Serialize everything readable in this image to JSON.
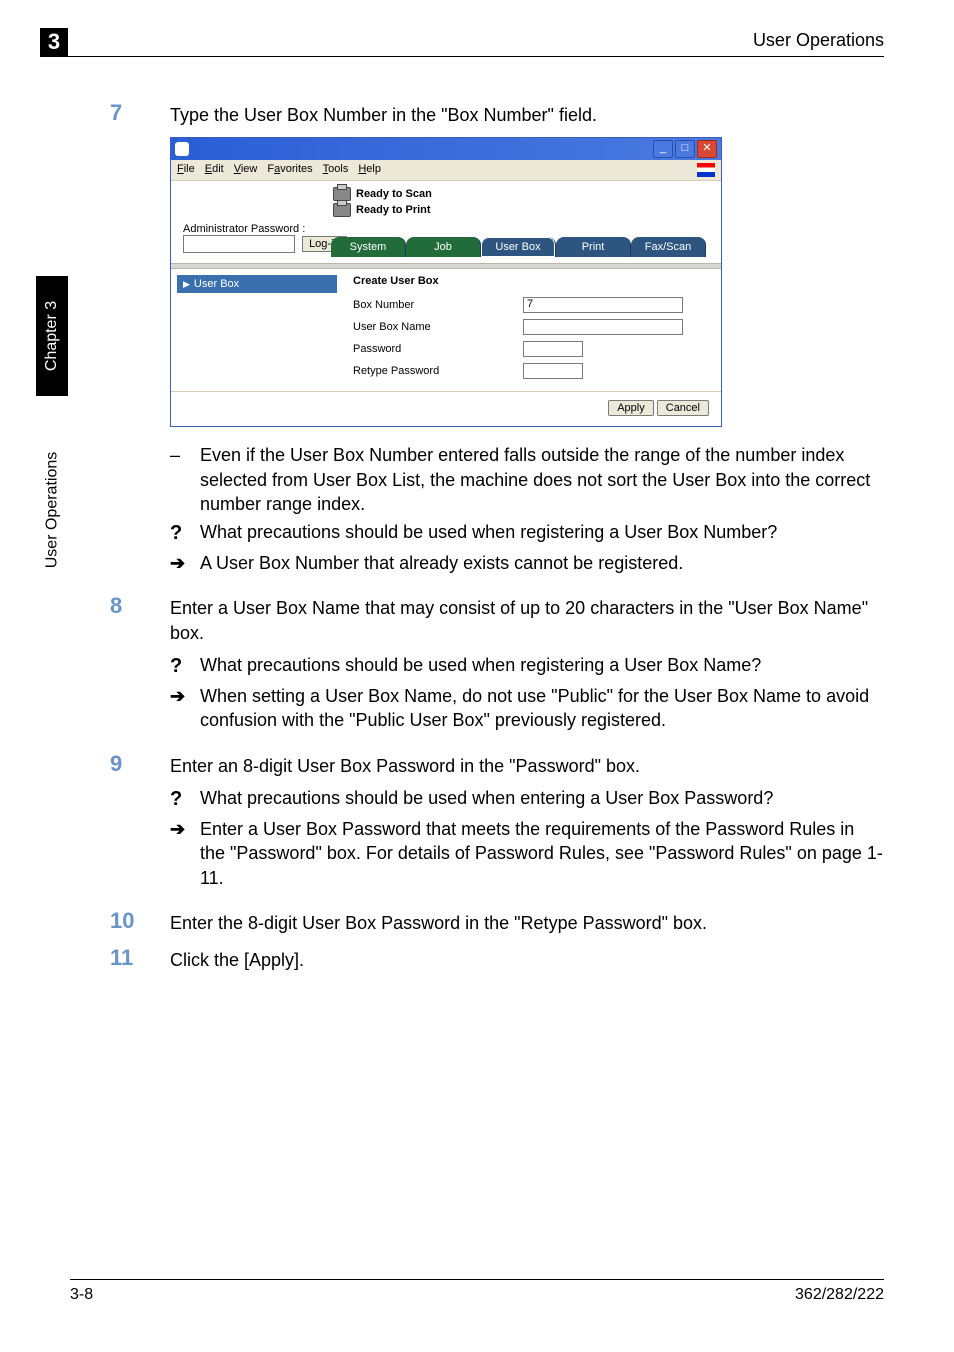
{
  "header": {
    "chapter_num": "3",
    "title": "User Operations"
  },
  "side": {
    "chapter_label": "Chapter 3",
    "section_label": "User Operations"
  },
  "steps": {
    "s7": {
      "num": "7",
      "text": "Type the User Box Number in the \"Box Number\" field."
    },
    "s8": {
      "num": "8",
      "text": "Enter a User Box Name that may consist of up to 20 characters in the \"User Box Name\" box."
    },
    "s9": {
      "num": "9",
      "text": "Enter an 8-digit User Box Password in the \"Password\" box."
    },
    "s10": {
      "num": "10",
      "text": "Enter the 8-digit User Box Password in the \"Retype Password\" box."
    },
    "s11": {
      "num": "11",
      "text": "Click the [Apply]."
    }
  },
  "s7_items": {
    "dash": "Even if the User Box Number entered falls outside the range of the number index selected from User Box List, the machine does not sort the User Box into the correct number range index.",
    "q": "What precautions should be used when registering a User Box Number?",
    "a": "A User Box Number that already exists cannot be registered."
  },
  "s8_items": {
    "q": "What precautions should be used when registering a User Box Name?",
    "a": "When setting a User Box Name, do not use \"Public\" for the User Box Name to avoid confusion with the \"Public User Box\" previously registered."
  },
  "s9_items": {
    "q": "What precautions should be used when entering a User Box Password?",
    "a": "Enter a User Box Password that meets the requirements of the Password Rules in the \"Password\" box. For details of Password Rules, see \"Password Rules\" on page 1-11."
  },
  "win": {
    "menu": {
      "file": "File",
      "edit": "Edit",
      "view": "View",
      "favorites": "Favorites",
      "tools": "Tools",
      "help": "Help"
    },
    "status1": "Ready to Scan",
    "status2": "Ready to Print",
    "admin_label": "Administrator Password :",
    "login": "Log-in",
    "tabs": {
      "system": "System",
      "job": "Job",
      "userbox": "User Box",
      "print": "Print",
      "faxscan": "Fax/Scan"
    },
    "side_head": "User Box",
    "panel_title": "Create User Box",
    "fields": {
      "box_number": "Box Number",
      "box_number_val": "7",
      "user_box_name": "User Box Name",
      "password": "Password",
      "retype": "Retype Password"
    },
    "apply": "Apply",
    "cancel": "Cancel"
  },
  "markers": {
    "dash": "–",
    "q": "?",
    "arrow": "➔"
  },
  "footer": {
    "left": "3-8",
    "right": "362/282/222"
  }
}
